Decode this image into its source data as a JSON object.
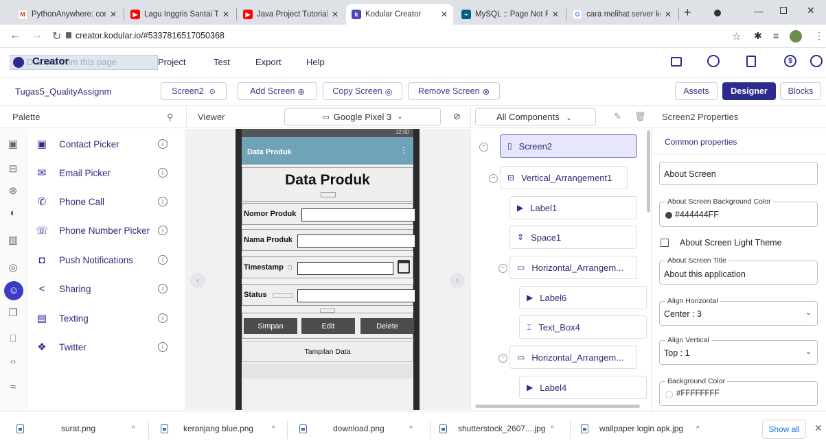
{
  "browser": {
    "tabs": [
      {
        "title": "PythonAnywhere: cont",
        "icon": "gmail-icon",
        "color": "#d93025"
      },
      {
        "title": "Lagu Inggris Santai Te",
        "icon": "youtube-icon",
        "color": "#ff0000"
      },
      {
        "title": "Java Project Tutorial -",
        "icon": "youtube-icon",
        "color": "#ff0000"
      },
      {
        "title": "Kodular Creator",
        "icon": "kodular-icon",
        "color": "#4a4ab5"
      },
      {
        "title": "MySQL :: Page Not Fou",
        "icon": "mysql-icon",
        "color": "#00618a"
      },
      {
        "title": "cara melihat server ko",
        "icon": "google-icon",
        "color": "#4285f4"
      }
    ],
    "url": "creator.kodular.io/#5337816517050368"
  },
  "app": {
    "logo_text": "Creator",
    "ghost_text": "D  audio from this page",
    "menu": [
      "Project",
      "Test",
      "Export",
      "Help"
    ],
    "project_name": "Tugas5_QualityAssignm",
    "screen_select": "Screen2",
    "add_screen": "Add Screen",
    "copy_screen": "Copy Screen",
    "remove_screen": "Remove Screen",
    "assets": "Assets",
    "designer": "Designer",
    "blocks": "Blocks"
  },
  "panels": {
    "palette_title": "Palette",
    "viewer_title": "Viewer",
    "device": "Google Pixel 3",
    "components_filter": "All Components",
    "properties_title": "Screen2 Properties"
  },
  "palette": {
    "items": [
      {
        "label": "Contact Picker",
        "icon": "contact-card-icon"
      },
      {
        "label": "Email Picker",
        "icon": "envelope-icon"
      },
      {
        "label": "Phone Call",
        "icon": "phone-icon"
      },
      {
        "label": "Phone Number Picker",
        "icon": "phone-list-icon"
      },
      {
        "label": "Push Notifications",
        "icon": "notification-icon"
      },
      {
        "label": "Sharing",
        "icon": "share-icon"
      },
      {
        "label": "Texting",
        "icon": "message-icon"
      },
      {
        "label": "Twitter",
        "icon": "twitter-icon"
      }
    ]
  },
  "phone": {
    "status_time": "12:00",
    "appbar_title": "Data Produk",
    "heading": "Data Produk",
    "fields": [
      {
        "label": "Nomor Produk"
      },
      {
        "label": "Nama Produk"
      },
      {
        "label": "Timestamp"
      },
      {
        "label": "Status"
      }
    ],
    "buttons": [
      "Simpan",
      "Edit",
      "Delete"
    ],
    "footer": "Tampilan Data"
  },
  "components": [
    {
      "name": "Screen2",
      "level": 0,
      "icon": "phone-icon",
      "selected": true
    },
    {
      "name": "Vertical_Arrangement1",
      "level": 1,
      "icon": "vertical-arrangement-icon"
    },
    {
      "name": "Label1",
      "level": 2,
      "icon": "label-icon"
    },
    {
      "name": "Space1",
      "level": 2,
      "icon": "space-icon"
    },
    {
      "name": "Horizontal_Arrangem...",
      "level": 2,
      "icon": "horizontal-arrangement-icon"
    },
    {
      "name": "Label6",
      "level": 3,
      "icon": "label-icon"
    },
    {
      "name": "Text_Box4",
      "level": 3,
      "icon": "textbox-icon"
    },
    {
      "name": "Horizontal_Arrangem...",
      "level": 2,
      "icon": "horizontal-arrangement-icon"
    },
    {
      "name": "Label4",
      "level": 3,
      "icon": "label-icon"
    }
  ],
  "properties": {
    "common_tab": "Common properties",
    "about_screen": "About Screen",
    "bg_color_label": "About Screen Background Color",
    "bg_color_value": "#444444FF",
    "light_theme": "About Screen Light Theme",
    "title_label": "About Screen Title",
    "title_value": "About this application",
    "align_h_label": "Align Horizontal",
    "align_h_value": "Center : 3",
    "align_v_label": "Align Vertical",
    "align_v_value": "Top : 1",
    "bgc_label": "Background Color",
    "bgc_value": "#FFFFFFFF"
  },
  "downloads": {
    "files": [
      "surat.png",
      "keranjang blue.png",
      "download.png",
      "shutterstock_2607....jpg",
      "wallpaper login apk.jpg"
    ],
    "show_all": "Show all"
  },
  "colors": {
    "accent": "#2b2c8e",
    "phone_appbar": "#6fa3b8",
    "selected_bg": "#e8e6fb"
  }
}
